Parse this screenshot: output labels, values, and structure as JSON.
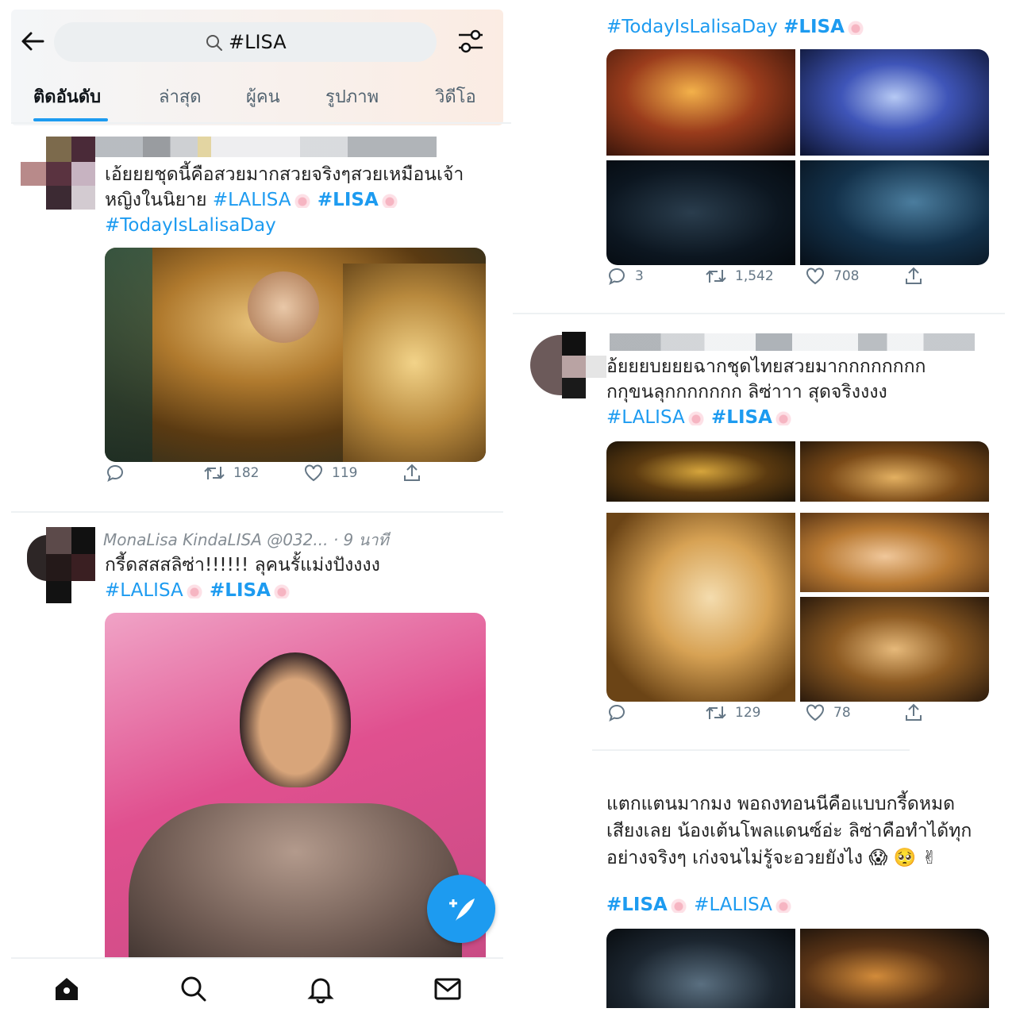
{
  "search": {
    "query": "#LISA"
  },
  "tabs": [
    {
      "label": "ติดอันดับ",
      "active": true
    },
    {
      "label": "ล่าสุด"
    },
    {
      "label": "ผู้คน"
    },
    {
      "label": "รูปภาพ"
    },
    {
      "label": "วิดีโอ"
    }
  ],
  "tweets": [
    {
      "text_line1": "เอ้ยยยชุดนี้คือสวยมากสวยจริงๆสวยเหมือนเจ้า",
      "text_line2": "หญิงในนิยาย",
      "tags": [
        "#LALISA",
        "#LISA",
        "#TodayIsLalisaDay"
      ],
      "replies": "",
      "retweets": "182",
      "likes": "119"
    },
    {
      "header": "MonaLisa KindaLISA  @032... · 9 นาที",
      "text_line1": "กรี้ดสสสลิซ่า!!!!!! ลุคนรั้แม่งปังงงง",
      "tags": [
        "#LALISA",
        "#LISA"
      ]
    },
    {
      "tags": [
        "#TodayIsLalisaDay",
        "#LISA"
      ],
      "replies": "3",
      "retweets": "1,542",
      "likes": "708"
    },
    {
      "text_line1": "อ้ยยยบยยยฉากชุดไทยสวยมากกกกกกกก",
      "text_line2": "กกุขนลุกกกกกกก ลิซ่าาา สุดจริงงงง",
      "tags": [
        "#LALISA",
        "#LISA"
      ],
      "retweets": "129",
      "likes": "78"
    },
    {
      "text_line1": "แตกแตนมากมง พอถงทอนนีคือแบบกรี้ดหมด",
      "text_line2": "เสียงเลย น้องเต้นโพลแดนซ์อ่ะ ลิซ่าคือทำได้ทุก",
      "text_line3": "อย่างจริงๆ เก่งจนไม่รู้จะอวยยังไง",
      "emojis": "😱 🥺 ✌",
      "tags": [
        "#LISA",
        "#LALISA"
      ]
    }
  ],
  "colors": {
    "accent": "#1d9bf0",
    "text": "#14171a",
    "muted": "#657786"
  },
  "icons": [
    "back-arrow-icon",
    "search-icon",
    "filter-icon",
    "reply-icon",
    "retweet-icon",
    "like-icon",
    "share-icon",
    "compose-icon",
    "home-icon",
    "bell-icon",
    "mail-icon"
  ]
}
